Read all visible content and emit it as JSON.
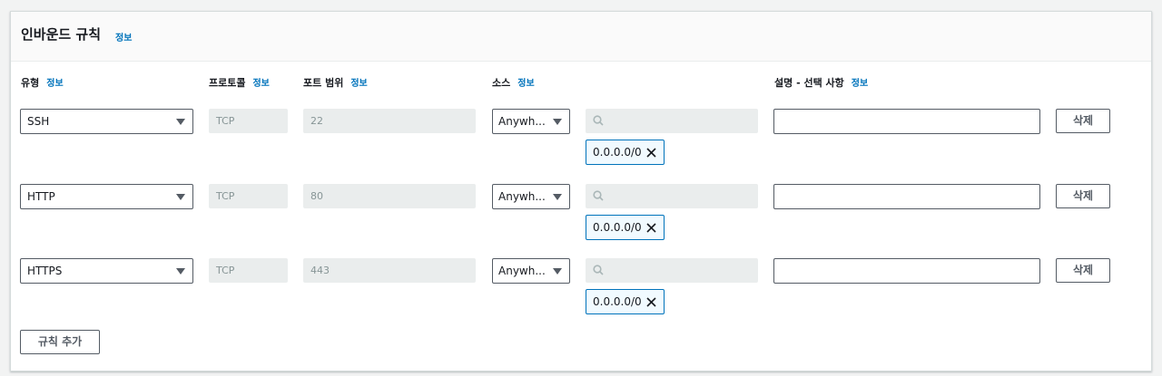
{
  "panel": {
    "title": "인바운드 규칙",
    "info": "정보"
  },
  "columns": {
    "type": "유형",
    "protocol": "프로토콜",
    "port_range": "포트 범위",
    "source": "소스",
    "description": "설명 - 선택 사항",
    "info": "정보"
  },
  "rules": [
    {
      "type": "SSH",
      "protocol": "TCP",
      "port": "22",
      "source": "Anywh...",
      "search": "",
      "cidr": "0.0.0.0/0",
      "description": "",
      "delete": "삭제"
    },
    {
      "type": "HTTP",
      "protocol": "TCP",
      "port": "80",
      "source": "Anywh...",
      "search": "",
      "cidr": "0.0.0.0/0",
      "description": "",
      "delete": "삭제"
    },
    {
      "type": "HTTPS",
      "protocol": "TCP",
      "port": "443",
      "source": "Anywh...",
      "search": "",
      "cidr": "0.0.0.0/0",
      "description": "",
      "delete": "삭제"
    }
  ],
  "add_rule_label": "규칙 추가",
  "colors": {
    "link": "#0073bb",
    "token_border": "#0073bb",
    "disabled_bg": "#eaeded"
  }
}
